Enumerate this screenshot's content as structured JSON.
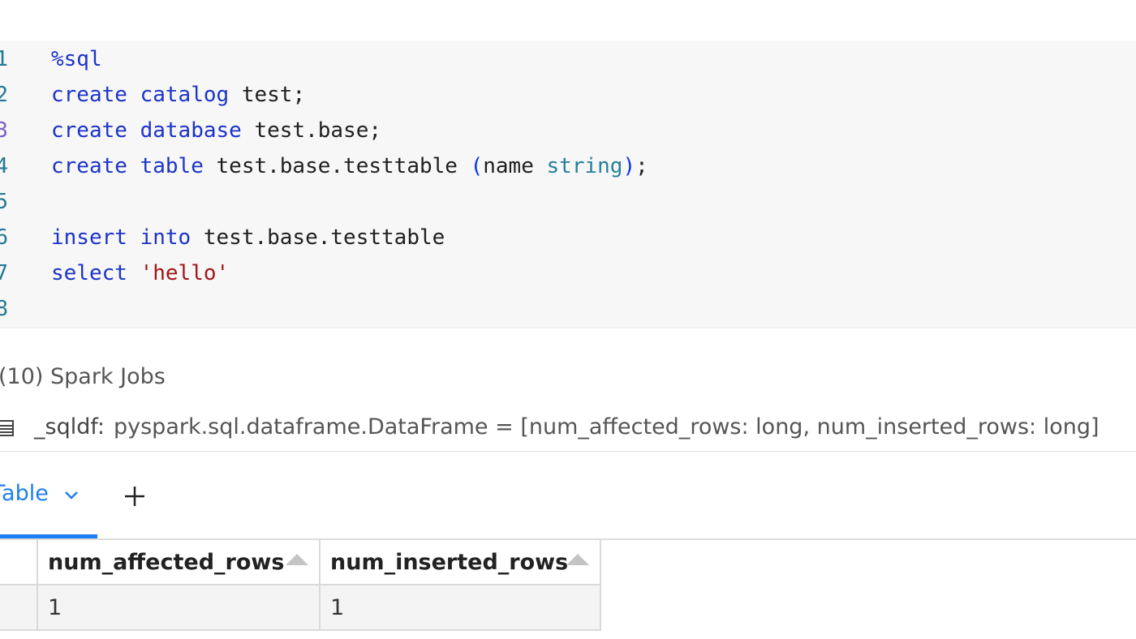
{
  "editor": {
    "line_numbers": [
      "1",
      "2",
      "3",
      "4",
      "5",
      "6",
      "7",
      "8"
    ],
    "lines": {
      "l1": {
        "magic": "%sql"
      },
      "l2": {
        "create": "create",
        "catalog": "catalog",
        "name": "test",
        "semi": ";"
      },
      "l3": {
        "create": "create",
        "database": "database",
        "name": "test.base",
        "semi": ";"
      },
      "l4": {
        "create": "create",
        "table": "table",
        "name": "test.base.testtable",
        "open": "(",
        "col": "name",
        "type": "string",
        "close": ")",
        "semi": ";"
      },
      "l6": {
        "insert": "insert",
        "into": "into",
        "name": "test.base.testtable"
      },
      "l7": {
        "select": "select",
        "value": "'hello'"
      }
    }
  },
  "output": {
    "spark_jobs": "(10) Spark Jobs",
    "dataframe": {
      "name": "_sqldf:",
      "schema": "pyspark.sql.dataframe.DataFrame = [num_affected_rows: long, num_inserted_rows: long]"
    },
    "tab_label": "Table",
    "add_icon": "plus-icon",
    "table": {
      "columns": [
        "num_affected_rows",
        "num_inserted_rows"
      ],
      "rows": [
        [
          "1",
          "1"
        ]
      ]
    }
  },
  "colors": {
    "keyword": "#0000ff",
    "type": "#267f99",
    "string": "#a31515",
    "accent": "#1d7ff0"
  }
}
